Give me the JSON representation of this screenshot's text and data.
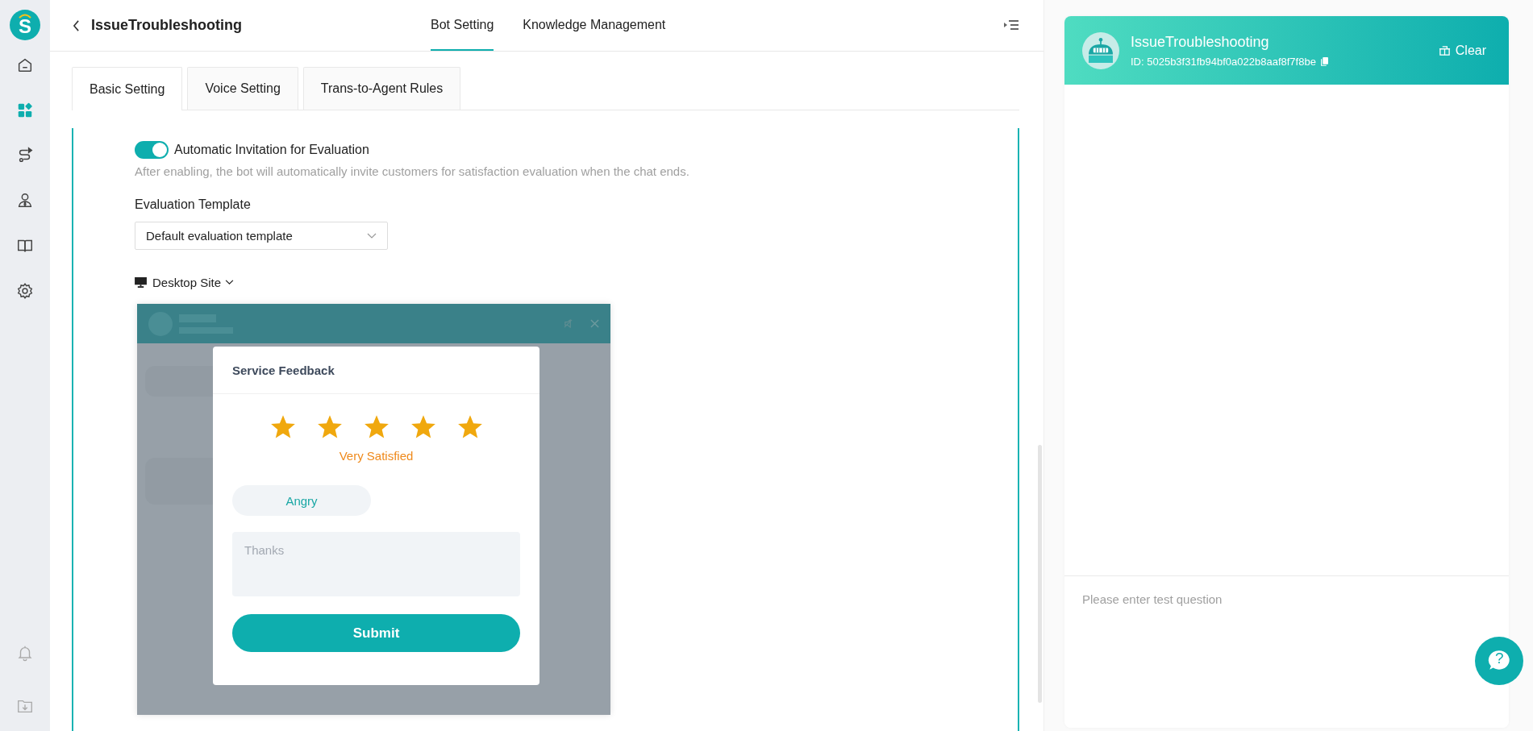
{
  "logo": {
    "letter": "S"
  },
  "nav": [
    {
      "selected": false
    },
    {
      "selected": true
    },
    {
      "selected": false
    },
    {
      "selected": false
    },
    {
      "selected": false
    },
    {
      "selected": false
    }
  ],
  "nav_bottom": [
    {
      "selected": false
    },
    {
      "selected": false
    }
  ],
  "header": {
    "title": "IssueTroubleshooting",
    "tabs": [
      {
        "label": "Bot Setting",
        "selected": true
      },
      {
        "label": "Knowledge Management",
        "selected": false
      }
    ]
  },
  "sub_tabs": [
    {
      "label": "Basic Setting",
      "selected": true
    },
    {
      "label": "Voice Setting",
      "selected": false
    },
    {
      "label": "Trans-to-Agent Rules",
      "selected": false
    }
  ],
  "evaluation": {
    "toggle": {
      "label": "Automatic Invitation for Evaluation",
      "on": true
    },
    "hint": "After enabling, the bot will automatically invite customers for satisfaction evaluation when the chat ends.",
    "template_label": "Evaluation Template",
    "template_value": "Default evaluation template",
    "site": "Desktop Site"
  },
  "preview": {
    "title": "Service Feedback",
    "stars": 5,
    "rating_text": "Very Satisfied",
    "tag": "Angry",
    "comment_placeholder": "Thanks",
    "submit": "Submit"
  },
  "test_panel": {
    "bot_name": "IssueTroubleshooting",
    "bot_id": "ID: 5025b3f31fb94bf0a022b8aaf8f7f8be",
    "clear": "Clear",
    "placeholder": "Please enter test question"
  },
  "help": {
    "label": "?"
  }
}
